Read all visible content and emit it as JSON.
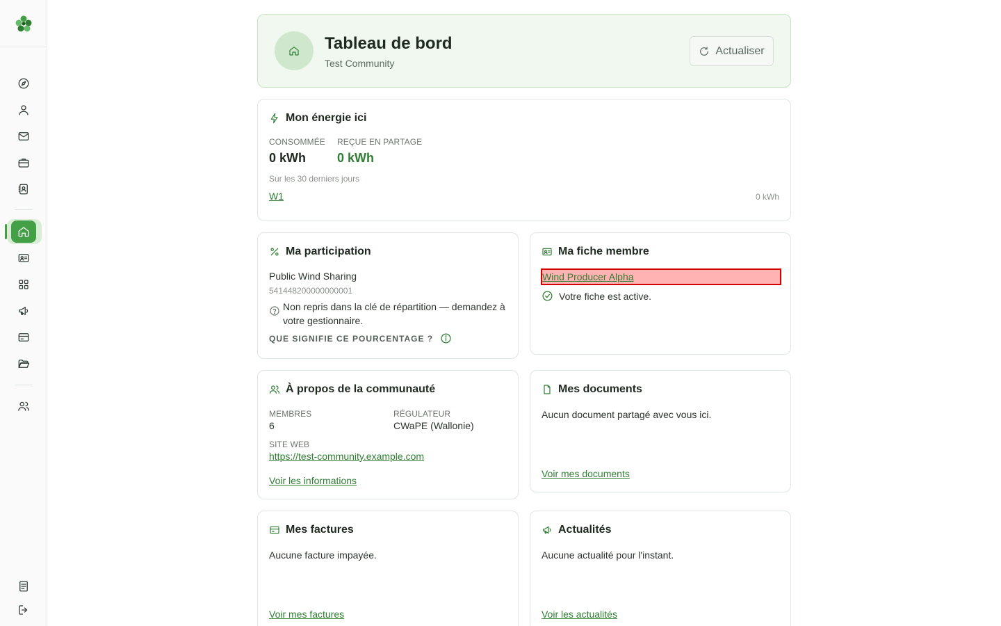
{
  "sidebar": {
    "logo": "clover-logo",
    "items": [
      {
        "name": "compass-icon"
      },
      {
        "name": "user-icon"
      },
      {
        "name": "mail-icon"
      },
      {
        "name": "briefcase-icon"
      },
      {
        "name": "contact-book-icon"
      },
      {
        "name": "home-icon",
        "active": true
      },
      {
        "name": "id-card-icon"
      },
      {
        "name": "grid-icon"
      },
      {
        "name": "megaphone-icon"
      },
      {
        "name": "credit-card-icon"
      },
      {
        "name": "folder-open-icon"
      },
      {
        "name": "users-icon"
      },
      {
        "name": "document-icon"
      },
      {
        "name": "logout-icon"
      }
    ]
  },
  "header": {
    "title": "Tableau de bord",
    "subtitle": "Test Community",
    "refresh_label": "Actualiser"
  },
  "energy": {
    "title": "Mon énergie ici",
    "consumed_label": "CONSOMMÉE",
    "consumed_value": "0 kWh",
    "shared_label": "REÇUE EN PARTAGE",
    "shared_value": "0 kWh",
    "period": "Sur les 30 derniers jours",
    "meter_link": "W1",
    "meter_value": "0 kWh"
  },
  "participation": {
    "title": "Ma participation",
    "name": "Public Wind Sharing",
    "ean": "541448200000000001",
    "notice": "Non repris dans la clé de répartition — demandez à votre gestionnaire.",
    "help_label": "QUE SIGNIFIE CE POURCENTAGE ?"
  },
  "member": {
    "title": "Ma fiche membre",
    "link": "Wind Producer Alpha",
    "status": "Votre fiche est active."
  },
  "community": {
    "title": "À propos de la communauté",
    "members_label": "MEMBRES",
    "members_value": "6",
    "regulator_label": "RÉGULATEUR",
    "regulator_value": "CWaPE (Wallonie)",
    "website_label": "SITE WEB",
    "website_link": "https://test-community.example.com",
    "more_link": "Voir les informations"
  },
  "documents": {
    "title": "Mes documents",
    "empty": "Aucun document partagé avec vous ici.",
    "link": "Voir mes documents"
  },
  "invoices": {
    "title": "Mes factures",
    "empty": "Aucune facture impayée.",
    "link": "Voir mes factures"
  },
  "news": {
    "title": "Actualités",
    "empty": "Aucune actualité pour l'instant.",
    "link": "Voir les actualités"
  },
  "colors": {
    "accent": "#43a047",
    "accent_dark": "#2e7d32",
    "header_bg": "#f1f8f0",
    "highlight_bg": "#ffb3b3",
    "highlight_border": "#d40000"
  }
}
